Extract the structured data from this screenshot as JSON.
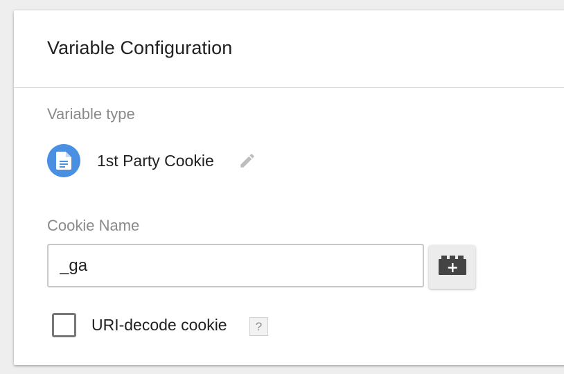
{
  "card": {
    "title": "Variable Configuration"
  },
  "variable_type": {
    "label": "Variable type",
    "name": "1st Party Cookie",
    "icon": "document-icon",
    "icon_color": "#4a90e2"
  },
  "cookie_name": {
    "label": "Cookie Name",
    "value": "_ga",
    "placeholder": ""
  },
  "uri_decode": {
    "label": "URI-decode cookie",
    "checked": false,
    "help_label": "?"
  }
}
